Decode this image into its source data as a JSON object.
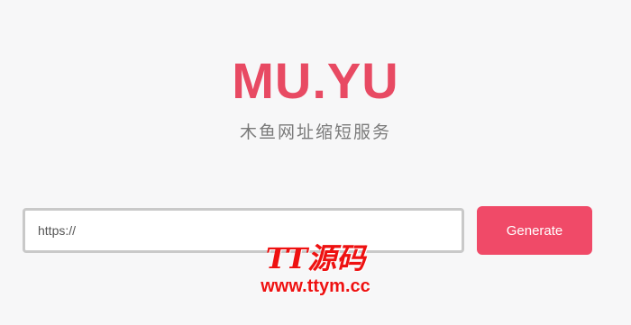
{
  "brand": {
    "logo": "MU.YU",
    "subtitle": "木鱼网址缩短服务",
    "accent_color": "#e84a63"
  },
  "form": {
    "url_placeholder": "https://",
    "url_value": "",
    "generate_label": "Generate",
    "button_color": "#f04a68"
  },
  "watermark": {
    "name": "TT源码",
    "url": "www.ttym.cc"
  }
}
